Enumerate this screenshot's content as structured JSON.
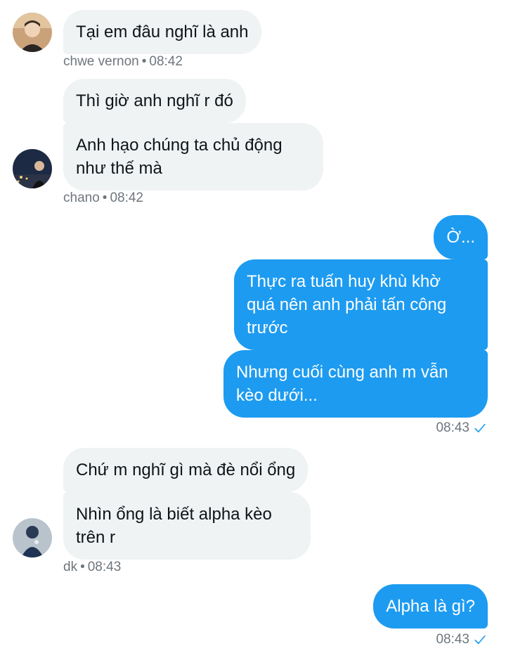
{
  "messages": [
    {
      "id": "m1",
      "dir": "in",
      "text": "Tại em đâu nghĩ là anh"
    },
    {
      "id": "m2",
      "dir": "in",
      "text": "Thì giờ anh nghĩ r đó"
    },
    {
      "id": "m3",
      "dir": "in",
      "text": "Anh hạo chúng ta chủ động\nnhư thế mà"
    },
    {
      "id": "m4",
      "dir": "out",
      "text": "Ờ..."
    },
    {
      "id": "m5",
      "dir": "out",
      "text": "Thực ra tuấn huy khù khờ\nquá nên anh phải tấn công\ntrước"
    },
    {
      "id": "m6",
      "dir": "out",
      "text": "Nhưng cuối cùng anh m vẫn\nkèo dưới..."
    },
    {
      "id": "m7",
      "dir": "in",
      "text": "Chứ m nghĩ gì mà đè nổi ổng"
    },
    {
      "id": "m8",
      "dir": "in",
      "text": "Nhìn ổng là biết alpha kèo\ntrên r"
    },
    {
      "id": "m9",
      "dir": "out",
      "text": "Alpha là gì?"
    }
  ],
  "meta": {
    "vernon": {
      "name": "chwe vernon",
      "sep": "•",
      "time": "08:42"
    },
    "chano": {
      "name": "chano",
      "sep": "•",
      "time": "08:42"
    },
    "sent1": {
      "time": "08:43",
      "status_icon": "check-icon"
    },
    "dk": {
      "name": "dk",
      "sep": "•",
      "time": "08:43"
    },
    "sent2": {
      "time": "08:43",
      "status_icon": "check-icon"
    }
  },
  "colors": {
    "incoming_bubble": "#eff3f4",
    "outgoing_bubble": "#1d9bf0",
    "meta_text": "#6e767d",
    "check": "#1d9bf0"
  }
}
